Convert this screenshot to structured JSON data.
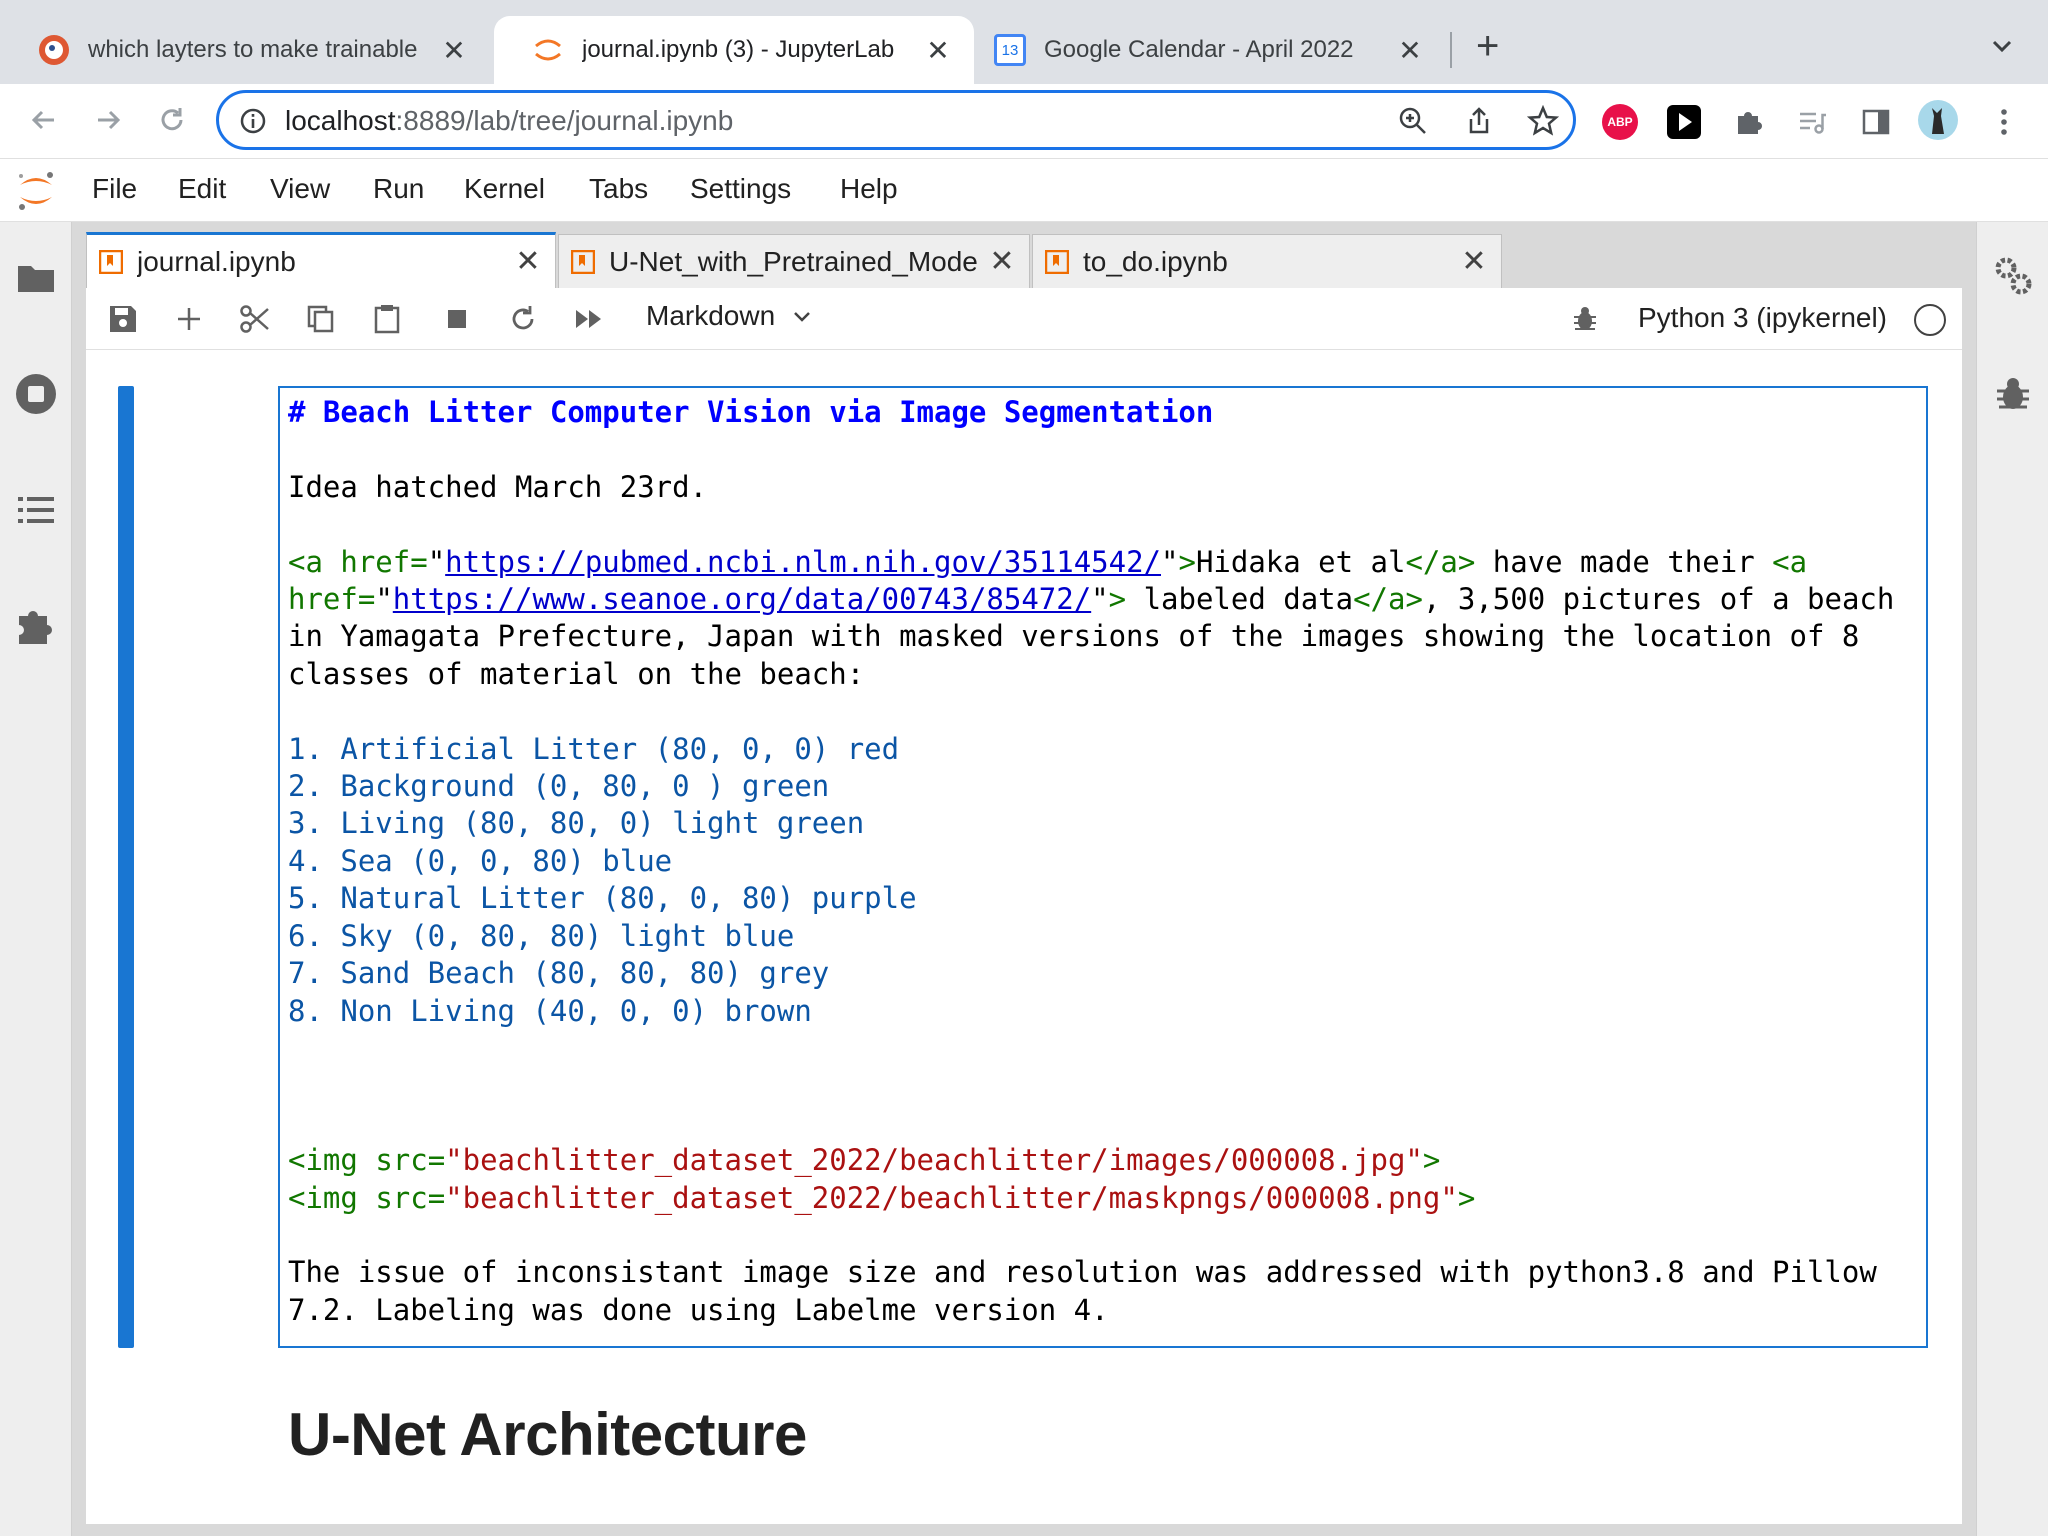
{
  "browser": {
    "tabs": [
      {
        "title": "which layters to make trainable",
        "active": false
      },
      {
        "title": "journal.ipynb (3) - JupyterLab",
        "active": true
      },
      {
        "title": "Google Calendar - April 2022",
        "active": false
      }
    ],
    "calendar_day": "13",
    "close_glyph": "✕",
    "new_tab_glyph": "+",
    "address": {
      "host": "localhost",
      "path": ":8889/lab/tree/journal.ipynb"
    },
    "abp_label": "ABP"
  },
  "jupyter": {
    "menu": [
      "File",
      "Edit",
      "View",
      "Run",
      "Kernel",
      "Tabs",
      "Settings",
      "Help"
    ],
    "notebook_tabs": [
      {
        "title": "journal.ipynb",
        "active": true
      },
      {
        "title": "U-Net_with_Pretrained_Model",
        "active": false
      },
      {
        "title": "to_do.ipynb",
        "active": false
      }
    ],
    "cell_type": "Markdown",
    "kernel_name": "Python 3 (ipykernel)",
    "cell": {
      "heading": "# Beach Litter Computer Vision via Image Segmentation",
      "idea": "Idea hatched March 23rd.",
      "a_open": "<a href=",
      "q": "\"",
      "url1": "https://pubmed.ncbi.nlm.nih.gov/35114542/",
      "gt": ">",
      "text1": "Hidaka et al",
      "a_close": "</a>",
      "text2": " have made their ",
      "a_open2": "<a",
      "href_eq": "href=",
      "url2": "https://www.seanoe.org/data/00743/85472/",
      "text3": " labeled data",
      "text4": ", 3,500 pictures of a beach",
      "line3": "in Yamagata Prefecture, Japan with masked versions of the images showing the location of 8",
      "line4": "classes of material on the beach:",
      "classes": [
        "1. Artificial Litter (80, 0, 0) red",
        "2. Background (0, 80, 0 ) green",
        "3. Living (80, 80, 0) light green",
        "4. Sea (0, 0, 80) blue",
        "5. Natural Litter (80, 0, 80) purple",
        "6. Sky (0, 80, 80) light blue",
        "7. Sand Beach (80, 80, 80) grey",
        "8. Non Living (40, 0, 0) brown"
      ],
      "img_open": "<img ",
      "src_eq": "src=",
      "img1": "\"beachlitter_dataset_2022/beachlitter/images/000008.jpg\"",
      "img2": "\"beachlitter_dataset_2022/beachlitter/maskpngs/000008.png\"",
      "note1": "The issue of inconsistant image size and resolution was addressed with python3.8 and Pillow",
      "note2": "7.2. Labeling was done using Labelme version 4."
    },
    "next_heading": "U-Net Architecture"
  }
}
